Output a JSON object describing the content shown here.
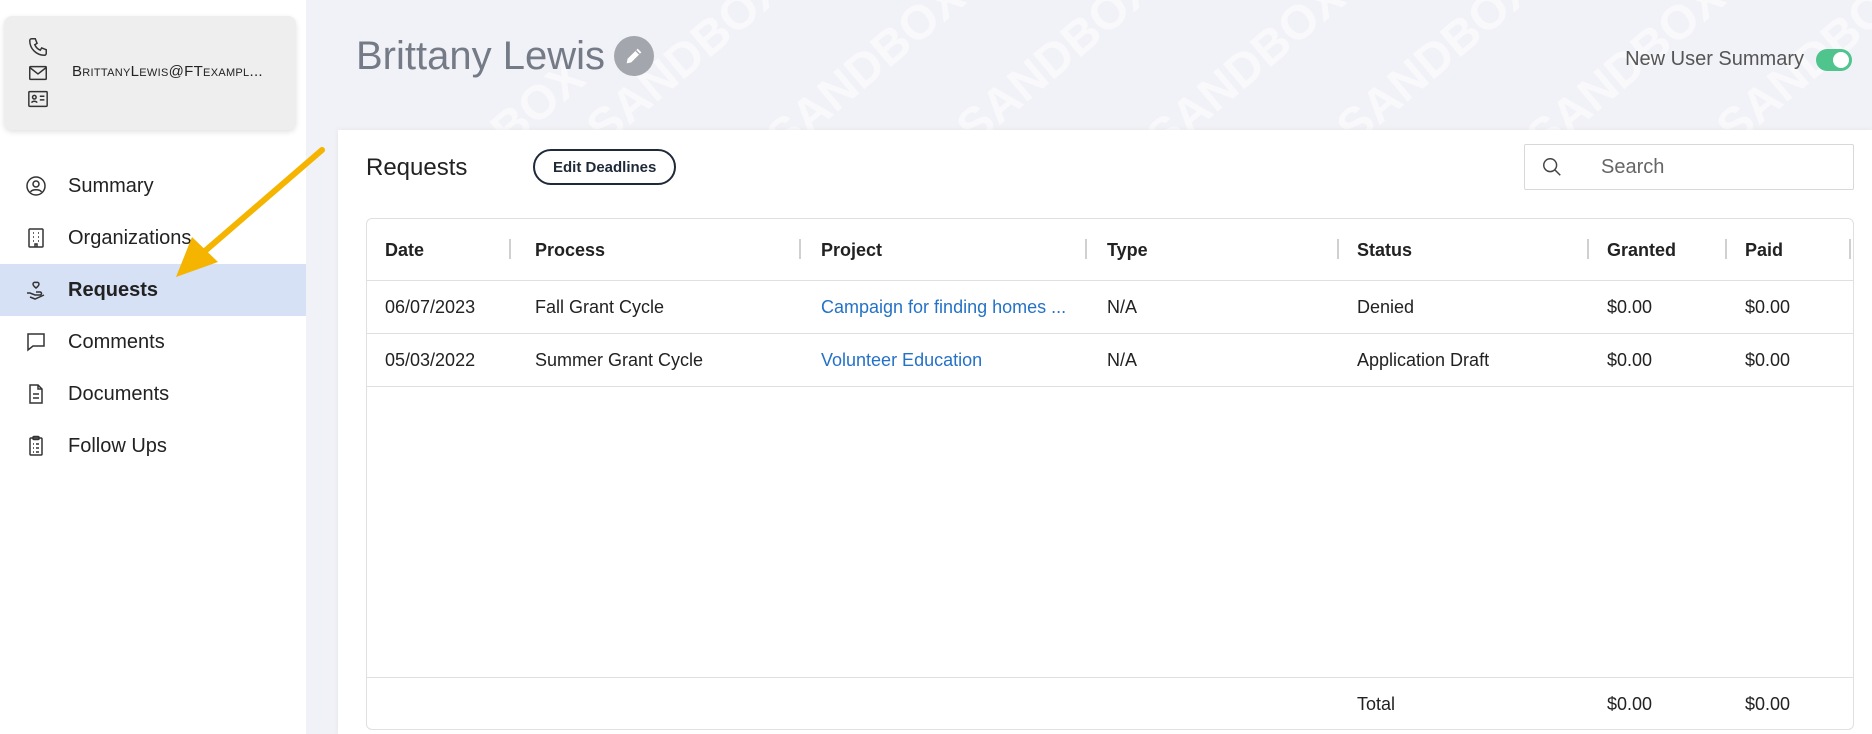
{
  "sidebar": {
    "email": "BrittanyLewis@FTexampl...",
    "items": [
      {
        "label": "Summary",
        "icon": "user-circle-icon"
      },
      {
        "label": "Organizations",
        "icon": "building-icon"
      },
      {
        "label": "Requests",
        "icon": "hand-giving-icon"
      },
      {
        "label": "Comments",
        "icon": "speech-bubble-icon"
      },
      {
        "label": "Documents",
        "icon": "document-icon"
      },
      {
        "label": "Follow Ups",
        "icon": "clipboard-icon"
      }
    ],
    "active_item": "Requests"
  },
  "header": {
    "user_name": "Brittany Lewis",
    "toggle_label": "New User Summary",
    "toggle_on": true,
    "watermark": "SANDBOX"
  },
  "requests": {
    "title": "Requests",
    "edit_deadlines_label": "Edit Deadlines",
    "search_placeholder": "Search",
    "columns": [
      "Date",
      "Process",
      "Project",
      "Type",
      "Status",
      "Granted",
      "Paid"
    ],
    "rows": [
      {
        "date": "06/07/2023",
        "process": "Fall Grant Cycle",
        "project": "Campaign for finding homes ...",
        "type": "N/A",
        "status": "Denied",
        "granted": "$0.00",
        "paid": "$0.00"
      },
      {
        "date": "05/03/2022",
        "process": "Summer Grant Cycle",
        "project": "Volunteer Education",
        "type": "N/A",
        "status": "Application Draft",
        "granted": "$0.00",
        "paid": "$0.00"
      }
    ],
    "footer": {
      "label": "Total",
      "granted": "$0.00",
      "paid": "$0.00"
    }
  },
  "colors": {
    "active_nav_bg": "#d6e1f6",
    "link": "#2472c8",
    "toggle_on": "#4fc48c",
    "arrow": "#f5b400"
  }
}
